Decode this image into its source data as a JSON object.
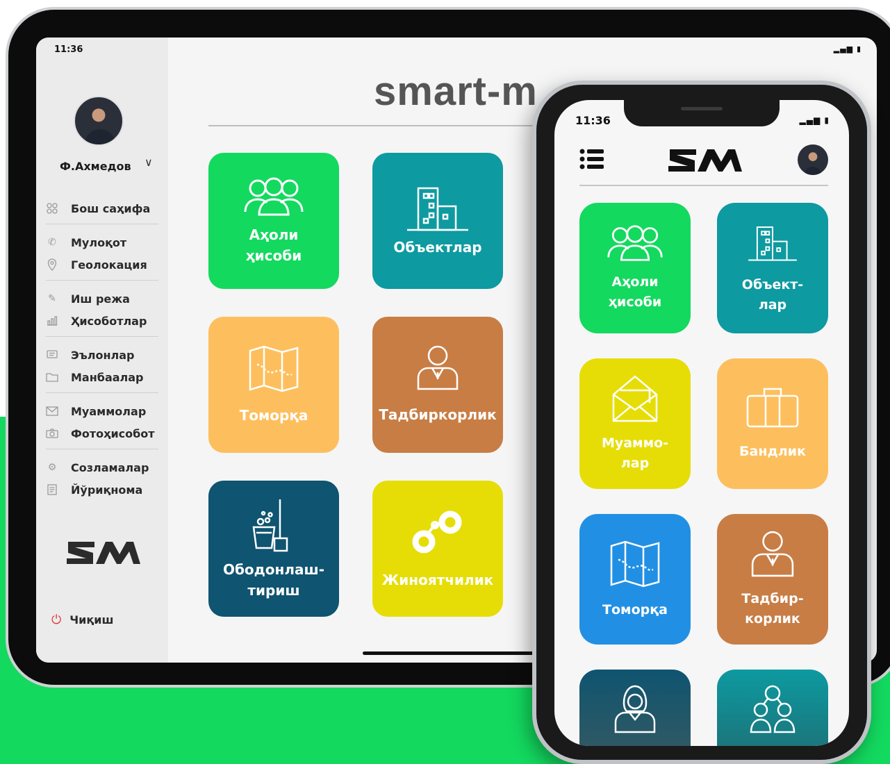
{
  "tablet": {
    "time": "11:36",
    "status_icons": "signal-wifi-battery",
    "user": {
      "name": "Ф.Ахмедов"
    },
    "title": "smart-m",
    "menu_groups": [
      [
        {
          "label": "Бош саҳифа",
          "icon": "grid-icon"
        }
      ],
      [
        {
          "label": "Мулоқот",
          "icon": "phone-icon"
        },
        {
          "label": "Геолокация",
          "icon": "location-pin-icon"
        }
      ],
      [
        {
          "label": "Иш режа",
          "icon": "edit-icon"
        },
        {
          "label": "Ҳисоботлар",
          "icon": "chart-icon"
        }
      ],
      [
        {
          "label": "Эълонлар",
          "icon": "announcement-icon"
        },
        {
          "label": "Манбаалар",
          "icon": "folder-icon"
        }
      ],
      [
        {
          "label": "Муаммолар",
          "icon": "envelope-icon"
        },
        {
          "label": "Фотоҳисобот",
          "icon": "camera-icon"
        }
      ],
      [
        {
          "label": "Созламалар",
          "icon": "gear-icon"
        },
        {
          "label": "Йўриқнома",
          "icon": "document-icon"
        }
      ]
    ],
    "logout": "Чиқиш",
    "tiles": [
      {
        "label": "Аҳоли\nҳисоби",
        "color": "#13d95f",
        "icon": "people-icon"
      },
      {
        "label": "Объектлар",
        "color": "#0d9aa0",
        "icon": "building-icon"
      },
      {
        "label": "Томорқа",
        "color": "#fdbf5e",
        "icon": "map-icon"
      },
      {
        "label": "Тадбиркорлик",
        "color": "#c87d45",
        "icon": "businessman-icon"
      },
      {
        "label": "Ободонлаш-\nтириш",
        "color": "#0f5470",
        "icon": "cleaning-icon"
      },
      {
        "label": "Жиноятчилик",
        "color": "#e6dd06",
        "icon": "handcuffs-icon"
      }
    ]
  },
  "phone": {
    "time": "11:36",
    "status_icons": "signal-wifi-battery",
    "tiles": [
      {
        "label": "Аҳоли\nҳисоби",
        "color": "#13d95f",
        "icon": "people-icon"
      },
      {
        "label": "Объект-\nлар",
        "color": "#0d9aa0",
        "icon": "building-icon"
      },
      {
        "label": "Муаммо-\nлар",
        "color": "#e6dd06",
        "icon": "envelope-icon"
      },
      {
        "label": "Бандлик",
        "color": "#fdbf5e",
        "icon": "suitcase-icon"
      },
      {
        "label": "Томорқа",
        "color": "#2190e4",
        "icon": "map-icon"
      },
      {
        "label": "Тадбир-\nкорлик",
        "color": "#c87d45",
        "icon": "businessman-icon"
      },
      {
        "label": "",
        "color": "#2f6370",
        "icon": "woman-icon"
      },
      {
        "label": "",
        "color": "#1a8890",
        "icon": "team-icon"
      }
    ]
  },
  "brand": {
    "logo_text": "SM"
  }
}
